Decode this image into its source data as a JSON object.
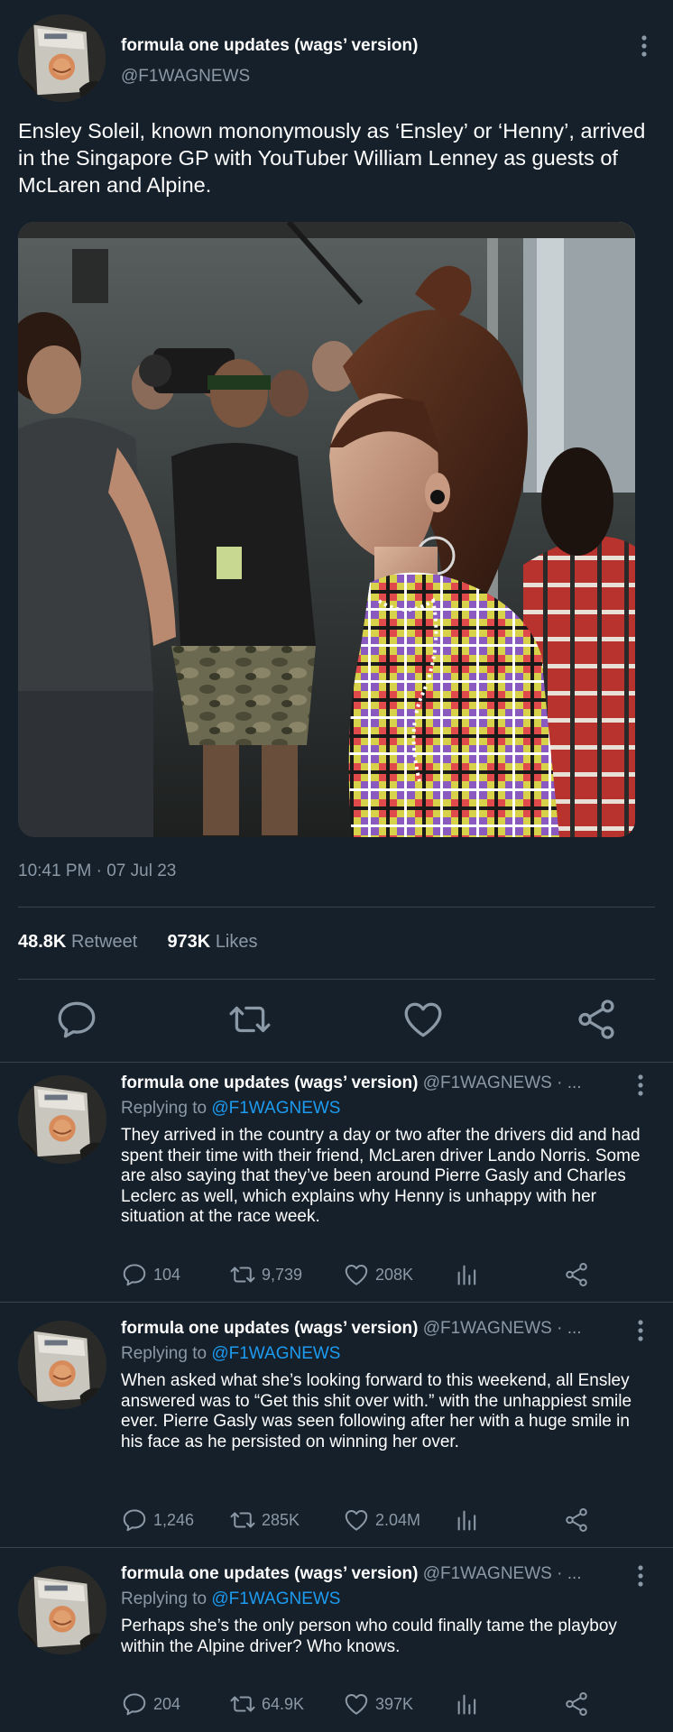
{
  "account": {
    "name": "formula one updates (wags’ version)",
    "handle": "@F1WAGNEWS"
  },
  "main_tweet": {
    "text": "Ensley Soleil, known mononymously as ‘Ensley’ or ‘Henny’, arrived in the Singapore GP with YouTuber William Lenney as guests of McLaren and Alpine.",
    "timestamp": "10:41 PM · 07 Jul 23",
    "retweets_count": "48.8K",
    "retweets_label": "Retweet",
    "likes_count": "973K",
    "likes_label": "Likes"
  },
  "replies": [
    {
      "name": "formula one updates (wags’ version)",
      "handle_time": "@F1WAGNEWS · ...",
      "replying_prefix": "Replying to",
      "replying_handle": "@F1WAGNEWS",
      "text": "They arrived in the country a day or two after the drivers did and had spent their time with their friend, McLaren driver Lando Norris. Some are also saying that they’ve been around Pierre Gasly and Charles Leclerc as well, which explains why Henny is unhappy with her situation at the race week.",
      "replies": "104",
      "retweets": "9,739",
      "likes": "208K"
    },
    {
      "name": "formula one updates (wags’ version)",
      "handle_time": "@F1WAGNEWS · ...",
      "replying_prefix": "Replying to",
      "replying_handle": "@F1WAGNEWS",
      "text": "When asked what she’s looking forward to this weekend, all Ensley answered was to “Get this shit over with.” with the unhappiest smile ever. Pierre Gasly was seen following after her with a huge smile in his face as he persisted on winning her over.",
      "replies": "1,246",
      "retweets": "285K",
      "likes": "2.04M"
    },
    {
      "name": "formula one updates (wags’ version)",
      "handle_time": "@F1WAGNEWS · ...",
      "replying_prefix": "Replying to",
      "replying_handle": "@F1WAGNEWS",
      "text": "Perhaps she’s the only person who could finally tame the playboy within the Alpine driver? Who knows.",
      "replies": "204",
      "retweets": "64.9K",
      "likes": "397K"
    }
  ],
  "icons": {
    "reply": "comment-bubble-icon",
    "retweet": "retweet-icon",
    "like": "heart-icon",
    "analytics": "bar-chart-icon",
    "share": "share-icon",
    "more": "vertical-ellipsis-icon"
  },
  "colors": {
    "background": "#15202b",
    "divider": "#38444d",
    "muted_text": "#8b98a5",
    "link": "#1d9bf0",
    "text": "#ffffff"
  }
}
